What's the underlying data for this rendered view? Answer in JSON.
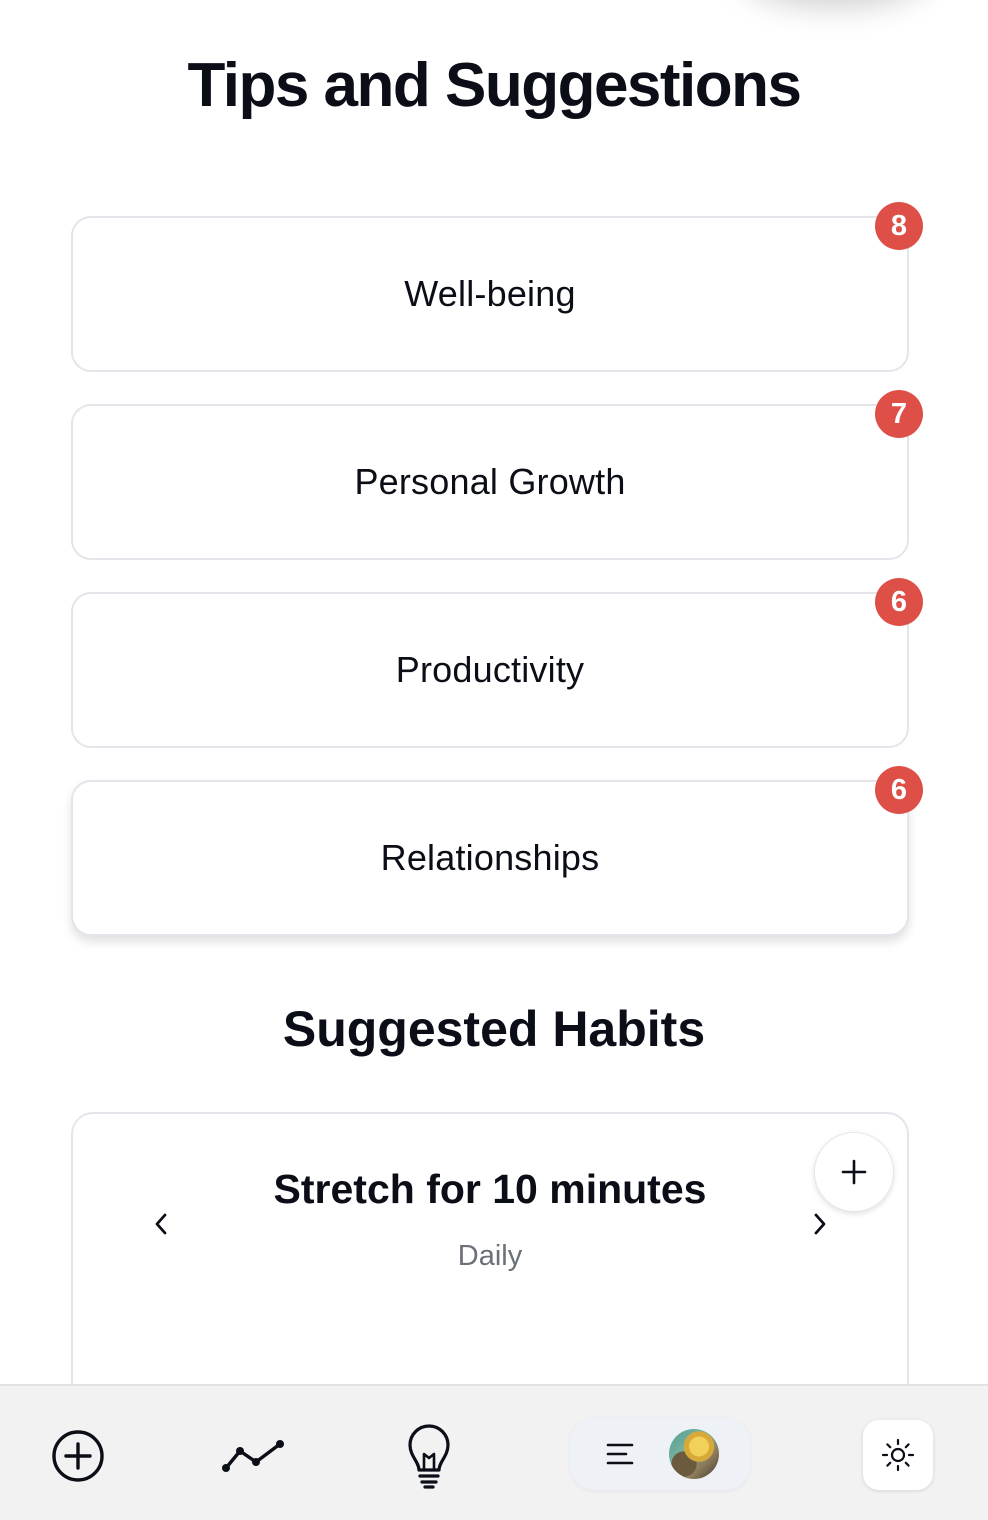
{
  "header": {
    "title": "Tips and Suggestions"
  },
  "categories": [
    {
      "label": "Well-being",
      "count": "8"
    },
    {
      "label": "Personal Growth",
      "count": "7"
    },
    {
      "label": "Productivity",
      "count": "6"
    },
    {
      "label": "Relationships",
      "count": "6"
    }
  ],
  "suggested": {
    "title": "Suggested Habits",
    "habit": {
      "name": "Stretch for 10 minutes",
      "frequency": "Daily"
    },
    "icons": {
      "prev": "chevron-left-icon",
      "next": "chevron-right-icon",
      "add": "plus-icon"
    }
  },
  "bottom_bar": {
    "icons": [
      "plus-circle-icon",
      "trend-line-icon",
      "lightbulb-icon",
      "menu-lines-icon",
      "avatar",
      "sun-icon"
    ]
  },
  "colors": {
    "badge": "#de4f47",
    "text": "#0b0d17",
    "muted": "#6b7079",
    "bar": "#f2f2f3"
  }
}
